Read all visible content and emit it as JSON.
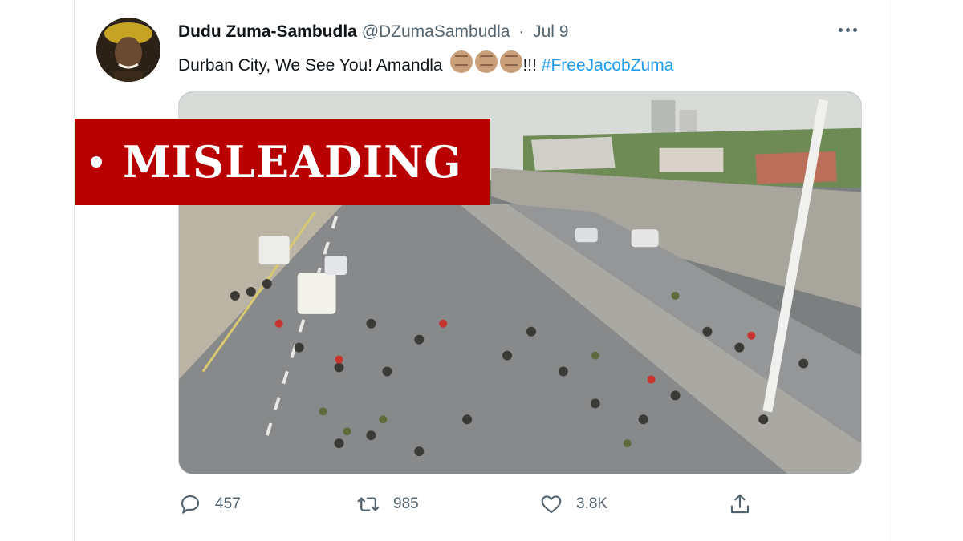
{
  "tweet": {
    "author_name": "Dudu Zuma-Sambudla",
    "handle": "@DZumaSambudla",
    "separator": "·",
    "date": "Jul 9",
    "text_main": "Durban City, We See You! Amandla",
    "emoji_icons": [
      "raised-fist-icon",
      "raised-fist-icon",
      "raised-fist-icon"
    ],
    "text_exclaim": "!!!",
    "hashtag": "#FreeJacobZuma"
  },
  "label": {
    "text": "MISLEADING",
    "color": "#b80000"
  },
  "actions": {
    "replies": "457",
    "retweets": "985",
    "likes": "3.8K"
  },
  "colors": {
    "text_primary": "#0f1419",
    "text_secondary": "#536471",
    "link": "#1d9bf0"
  }
}
